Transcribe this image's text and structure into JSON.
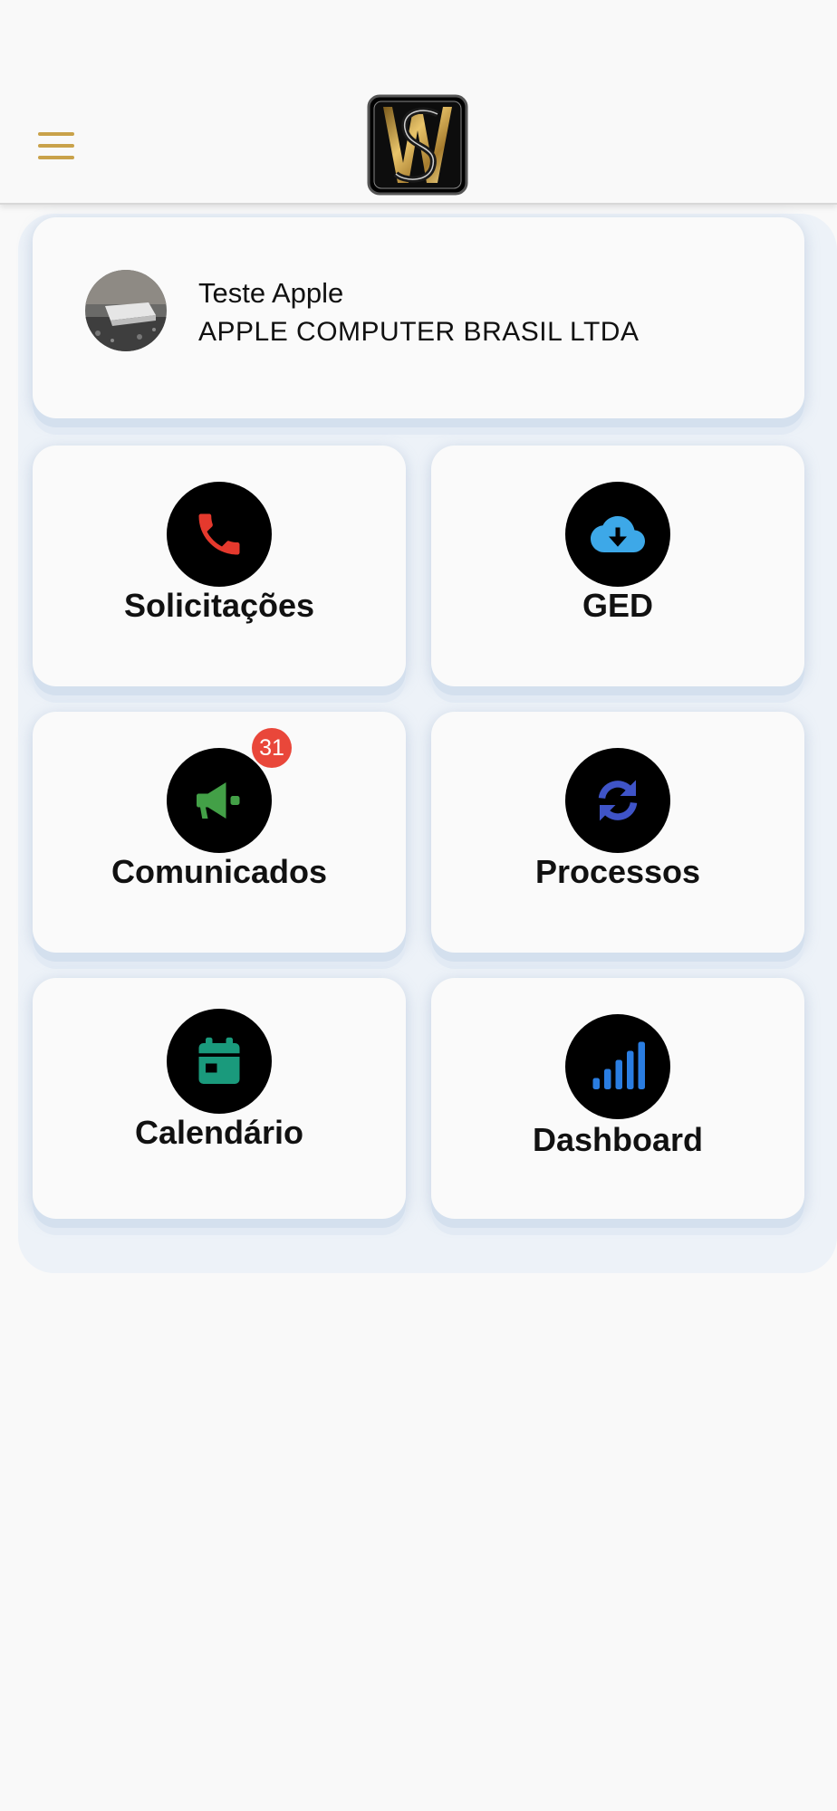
{
  "header": {
    "menu_icon": "hamburger-icon",
    "logo_icon": "sw-logo"
  },
  "profile": {
    "name": "Teste Apple",
    "company": "APPLE COMPUTER BRASIL LTDA"
  },
  "tiles": [
    {
      "label": "Solicitações",
      "icon": "phone-icon",
      "icon_color": "#e5392d"
    },
    {
      "label": "GED",
      "icon": "cloud-download-icon",
      "icon_color": "#3da8e8"
    },
    {
      "label": "Comunicados",
      "icon": "megaphone-icon",
      "icon_color": "#43a047",
      "badge": "31"
    },
    {
      "label": "Processos",
      "icon": "sync-icon",
      "icon_color": "#3f54c8"
    },
    {
      "label": "Calendário",
      "icon": "calendar-icon",
      "icon_color": "#1a9a7c"
    },
    {
      "label": "Dashboard",
      "icon": "signal-bars-icon",
      "icon_color": "#2a7de1"
    }
  ],
  "colors": {
    "accent": "#c9a24a",
    "badge": "#e9473a"
  }
}
